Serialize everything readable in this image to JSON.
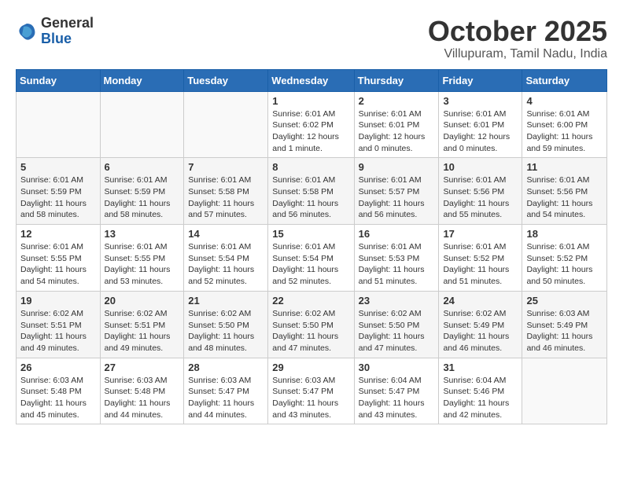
{
  "header": {
    "logo_line1": "General",
    "logo_line2": "Blue",
    "month": "October 2025",
    "location": "Villupuram, Tamil Nadu, India"
  },
  "weekdays": [
    "Sunday",
    "Monday",
    "Tuesday",
    "Wednesday",
    "Thursday",
    "Friday",
    "Saturday"
  ],
  "weeks": [
    [
      {
        "day": "",
        "info": ""
      },
      {
        "day": "",
        "info": ""
      },
      {
        "day": "",
        "info": ""
      },
      {
        "day": "1",
        "info": "Sunrise: 6:01 AM\nSunset: 6:02 PM\nDaylight: 12 hours\nand 1 minute."
      },
      {
        "day": "2",
        "info": "Sunrise: 6:01 AM\nSunset: 6:01 PM\nDaylight: 12 hours\nand 0 minutes."
      },
      {
        "day": "3",
        "info": "Sunrise: 6:01 AM\nSunset: 6:01 PM\nDaylight: 12 hours\nand 0 minutes."
      },
      {
        "day": "4",
        "info": "Sunrise: 6:01 AM\nSunset: 6:00 PM\nDaylight: 11 hours\nand 59 minutes."
      }
    ],
    [
      {
        "day": "5",
        "info": "Sunrise: 6:01 AM\nSunset: 5:59 PM\nDaylight: 11 hours\nand 58 minutes."
      },
      {
        "day": "6",
        "info": "Sunrise: 6:01 AM\nSunset: 5:59 PM\nDaylight: 11 hours\nand 58 minutes."
      },
      {
        "day": "7",
        "info": "Sunrise: 6:01 AM\nSunset: 5:58 PM\nDaylight: 11 hours\nand 57 minutes."
      },
      {
        "day": "8",
        "info": "Sunrise: 6:01 AM\nSunset: 5:58 PM\nDaylight: 11 hours\nand 56 minutes."
      },
      {
        "day": "9",
        "info": "Sunrise: 6:01 AM\nSunset: 5:57 PM\nDaylight: 11 hours\nand 56 minutes."
      },
      {
        "day": "10",
        "info": "Sunrise: 6:01 AM\nSunset: 5:56 PM\nDaylight: 11 hours\nand 55 minutes."
      },
      {
        "day": "11",
        "info": "Sunrise: 6:01 AM\nSunset: 5:56 PM\nDaylight: 11 hours\nand 54 minutes."
      }
    ],
    [
      {
        "day": "12",
        "info": "Sunrise: 6:01 AM\nSunset: 5:55 PM\nDaylight: 11 hours\nand 54 minutes."
      },
      {
        "day": "13",
        "info": "Sunrise: 6:01 AM\nSunset: 5:55 PM\nDaylight: 11 hours\nand 53 minutes."
      },
      {
        "day": "14",
        "info": "Sunrise: 6:01 AM\nSunset: 5:54 PM\nDaylight: 11 hours\nand 52 minutes."
      },
      {
        "day": "15",
        "info": "Sunrise: 6:01 AM\nSunset: 5:54 PM\nDaylight: 11 hours\nand 52 minutes."
      },
      {
        "day": "16",
        "info": "Sunrise: 6:01 AM\nSunset: 5:53 PM\nDaylight: 11 hours\nand 51 minutes."
      },
      {
        "day": "17",
        "info": "Sunrise: 6:01 AM\nSunset: 5:52 PM\nDaylight: 11 hours\nand 51 minutes."
      },
      {
        "day": "18",
        "info": "Sunrise: 6:01 AM\nSunset: 5:52 PM\nDaylight: 11 hours\nand 50 minutes."
      }
    ],
    [
      {
        "day": "19",
        "info": "Sunrise: 6:02 AM\nSunset: 5:51 PM\nDaylight: 11 hours\nand 49 minutes."
      },
      {
        "day": "20",
        "info": "Sunrise: 6:02 AM\nSunset: 5:51 PM\nDaylight: 11 hours\nand 49 minutes."
      },
      {
        "day": "21",
        "info": "Sunrise: 6:02 AM\nSunset: 5:50 PM\nDaylight: 11 hours\nand 48 minutes."
      },
      {
        "day": "22",
        "info": "Sunrise: 6:02 AM\nSunset: 5:50 PM\nDaylight: 11 hours\nand 47 minutes."
      },
      {
        "day": "23",
        "info": "Sunrise: 6:02 AM\nSunset: 5:50 PM\nDaylight: 11 hours\nand 47 minutes."
      },
      {
        "day": "24",
        "info": "Sunrise: 6:02 AM\nSunset: 5:49 PM\nDaylight: 11 hours\nand 46 minutes."
      },
      {
        "day": "25",
        "info": "Sunrise: 6:03 AM\nSunset: 5:49 PM\nDaylight: 11 hours\nand 46 minutes."
      }
    ],
    [
      {
        "day": "26",
        "info": "Sunrise: 6:03 AM\nSunset: 5:48 PM\nDaylight: 11 hours\nand 45 minutes."
      },
      {
        "day": "27",
        "info": "Sunrise: 6:03 AM\nSunset: 5:48 PM\nDaylight: 11 hours\nand 44 minutes."
      },
      {
        "day": "28",
        "info": "Sunrise: 6:03 AM\nSunset: 5:47 PM\nDaylight: 11 hours\nand 44 minutes."
      },
      {
        "day": "29",
        "info": "Sunrise: 6:03 AM\nSunset: 5:47 PM\nDaylight: 11 hours\nand 43 minutes."
      },
      {
        "day": "30",
        "info": "Sunrise: 6:04 AM\nSunset: 5:47 PM\nDaylight: 11 hours\nand 43 minutes."
      },
      {
        "day": "31",
        "info": "Sunrise: 6:04 AM\nSunset: 5:46 PM\nDaylight: 11 hours\nand 42 minutes."
      },
      {
        "day": "",
        "info": ""
      }
    ]
  ]
}
